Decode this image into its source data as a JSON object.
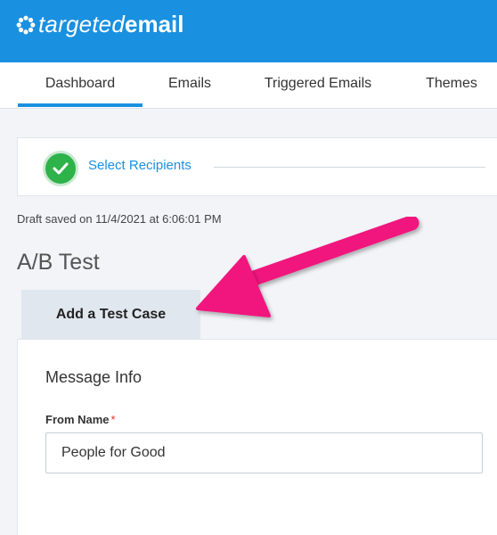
{
  "brand": {
    "light": "targeted",
    "bold": "email"
  },
  "nav": {
    "items": [
      {
        "label": "Dashboard",
        "active": true
      },
      {
        "label": "Emails"
      },
      {
        "label": "Triggered Emails"
      },
      {
        "label": "Themes"
      }
    ]
  },
  "steps": {
    "select_recipients": "Select Recipients"
  },
  "draft_status": "Draft saved on 11/4/2021 at 6:06:01 PM",
  "page_title": "A/B Test",
  "tab": {
    "label": "Add a Test Case"
  },
  "form": {
    "section_title": "Message Info",
    "from_name_label": "From Name",
    "required_marker": "*",
    "from_name_value": "People for Good"
  },
  "colors": {
    "brand": "#1a90e0",
    "success": "#2eb24a",
    "annotation_arrow": "#f0197d",
    "required": "#e0342a"
  },
  "icons": {
    "logo": "gear-flower-icon",
    "step_done": "check-circle-icon"
  }
}
